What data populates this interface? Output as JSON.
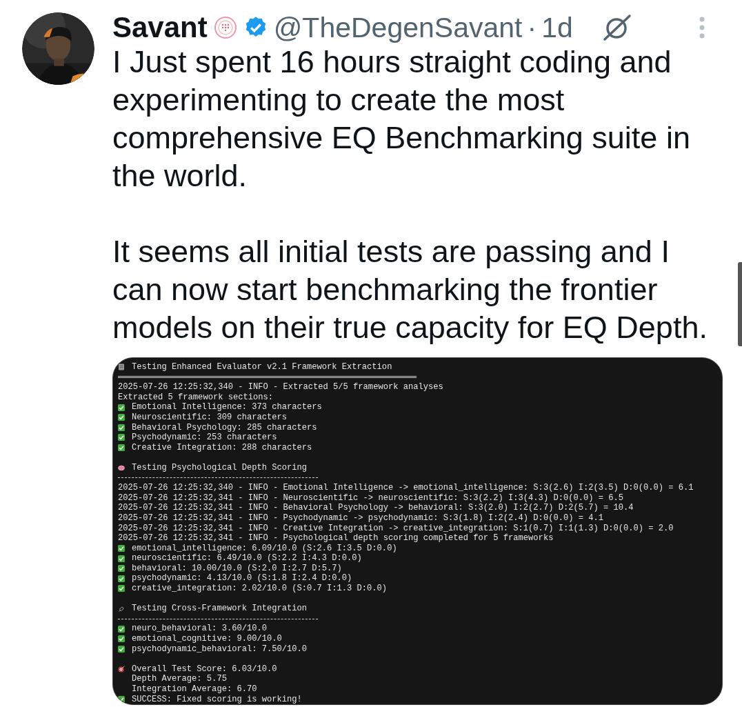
{
  "author": {
    "name": "Savant",
    "handle": "@TheDegenSavant",
    "separator": "·",
    "time": "1d"
  },
  "paragraphs": [
    "I Just spent 16 hours straight coding and experimenting to create the most comprehensive EQ Benchmarking suite in the world.",
    "It seems all initial tests are passing and I can now start benchmarking the frontier models on their true capacity for EQ Depth."
  ],
  "terminal": {
    "lines": [
      {
        "kind": "title",
        "text": "Testing Enhanced Evaluator v2.1 Framework Extraction"
      },
      {
        "kind": "divider"
      },
      {
        "kind": "plain",
        "text": "2025-07-26 12:25:32,340 - INFO - Extracted 5/5 framework analyses"
      },
      {
        "kind": "plain",
        "text": "Extracted 5 framework sections:"
      },
      {
        "kind": "check",
        "text": "Emotional Intelligence: 373 characters"
      },
      {
        "kind": "check",
        "text": "Neuroscientific: 309 characters"
      },
      {
        "kind": "check",
        "text": "Behavioral Psychology: 285 characters"
      },
      {
        "kind": "check",
        "text": "Psychodynamic: 253 characters"
      },
      {
        "kind": "check",
        "text": "Creative Integration: 288 characters"
      },
      {
        "kind": "blank"
      },
      {
        "kind": "depth",
        "text": "Testing Psychological Depth Scoring"
      },
      {
        "kind": "rule"
      },
      {
        "kind": "plain",
        "text": "2025-07-26 12:25:32,340 - INFO - Emotional Intelligence -> emotional_intelligence: S:3(2.6) I:2(3.5) D:0(0.0) = 6.1"
      },
      {
        "kind": "plain",
        "text": "2025-07-26 12:25:32,341 - INFO - Neuroscientific -> neuroscientific: S:3(2.2) I:3(4.3) D:0(0.0) = 6.5"
      },
      {
        "kind": "plain",
        "text": "2025-07-26 12:25:32,341 - INFO - Behavioral Psychology -> behavioral: S:3(2.0) I:2(2.7) D:2(5.7) = 10.4"
      },
      {
        "kind": "plain",
        "text": "2025-07-26 12:25:32,341 - INFO - Psychodynamic -> psychodynamic: S:3(1.8) I:2(2.4) D:0(0.0) = 4.1"
      },
      {
        "kind": "plain",
        "text": "2025-07-26 12:25:32,341 - INFO - Creative Integration -> creative_integration: S:1(0.7) I:1(1.3) D:0(0.0) = 2.0"
      },
      {
        "kind": "plain",
        "text": "2025-07-26 12:25:32,341 - INFO - Psychological depth scoring completed for 5 frameworks"
      },
      {
        "kind": "check",
        "text": "emotional_intelligence: 6.09/10.0 (S:2.6 I:3.5 D:0.0)"
      },
      {
        "kind": "check",
        "text": "neuroscientific: 6.49/10.0 (S:2.2 I:4.3 D:0.0)"
      },
      {
        "kind": "check",
        "text": "behavioral: 10.00/10.0 (S:2.0 I:2.7 D:5.7)"
      },
      {
        "kind": "check",
        "text": "psychodynamic: 4.13/10.0 (S:1.8 I:2.4 D:0.0)"
      },
      {
        "kind": "check",
        "text": "creative_integration: 2.02/10.0 (S:0.7 I:1.3 D:0.0)"
      },
      {
        "kind": "blank"
      },
      {
        "kind": "cross",
        "text": "Testing Cross-Framework Integration"
      },
      {
        "kind": "rule"
      },
      {
        "kind": "check",
        "text": "neuro_behavioral: 3.60/10.0"
      },
      {
        "kind": "check",
        "text": "emotional_cognitive: 9.00/10.0"
      },
      {
        "kind": "check",
        "text": "psychodynamic_behavioral: 7.50/10.0"
      },
      {
        "kind": "blank"
      },
      {
        "kind": "result",
        "text": "Overall Test Score: 6.03/10.0"
      },
      {
        "kind": "indent",
        "text": "Depth Average: 5.75"
      },
      {
        "kind": "indent",
        "text": "Integration Average: 6.70"
      },
      {
        "kind": "check",
        "text": "SUCCESS: Fixed scoring is working!"
      }
    ]
  }
}
